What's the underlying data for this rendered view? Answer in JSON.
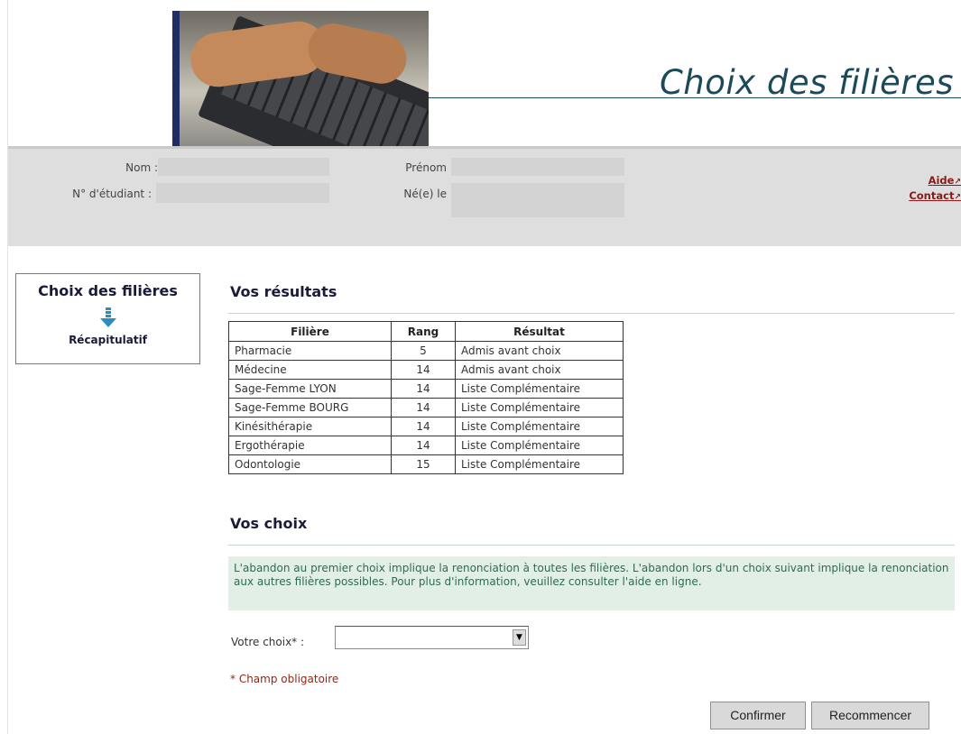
{
  "header": {
    "title": "Choix des filières"
  },
  "student_info": {
    "nom_label": "Nom :",
    "prenom_label": "Prénom",
    "numero_label": "N° d'étudiant :",
    "naissance_label": "Né(e) le",
    "nom_value": "",
    "prenom_value": "",
    "numero_value": "",
    "naissance_value": ""
  },
  "links": {
    "aide": "Aide",
    "contact": "Contact",
    "arrow": "↗"
  },
  "sidebar": {
    "title": "Choix des filières",
    "item": "Récapitulatif"
  },
  "results": {
    "heading": "Vos résultats",
    "columns": [
      "Filière",
      "Rang",
      "Résultat"
    ],
    "rows": [
      {
        "filiere": "Pharmacie",
        "rang": "5",
        "resultat": "Admis avant choix"
      },
      {
        "filiere": "Médecine",
        "rang": "14",
        "resultat": "Admis avant choix"
      },
      {
        "filiere": "Sage-Femme LYON",
        "rang": "14",
        "resultat": "Liste Complémentaire"
      },
      {
        "filiere": "Sage-Femme BOURG",
        "rang": "14",
        "resultat": "Liste Complémentaire"
      },
      {
        "filiere": "Kinésithérapie",
        "rang": "14",
        "resultat": "Liste Complémentaire"
      },
      {
        "filiere": "Ergothérapie",
        "rang": "14",
        "resultat": "Liste Complémentaire"
      },
      {
        "filiere": "Odontologie",
        "rang": "15",
        "resultat": "Liste Complémentaire"
      }
    ]
  },
  "choices": {
    "heading": "Vos choix",
    "notice": "L'abandon au premier choix implique la renonciation à toutes les filières. L'abandon lors d'un choix suivant implique la renonciation aux autres filières possibles. Pour plus d'information, veuillez consulter l'aide en ligne.",
    "select_label": "Votre choix* :",
    "select_value": "",
    "required_note": "* Champ obligatoire",
    "confirm_label": "Confirmer",
    "restart_label": "Recommencer"
  }
}
